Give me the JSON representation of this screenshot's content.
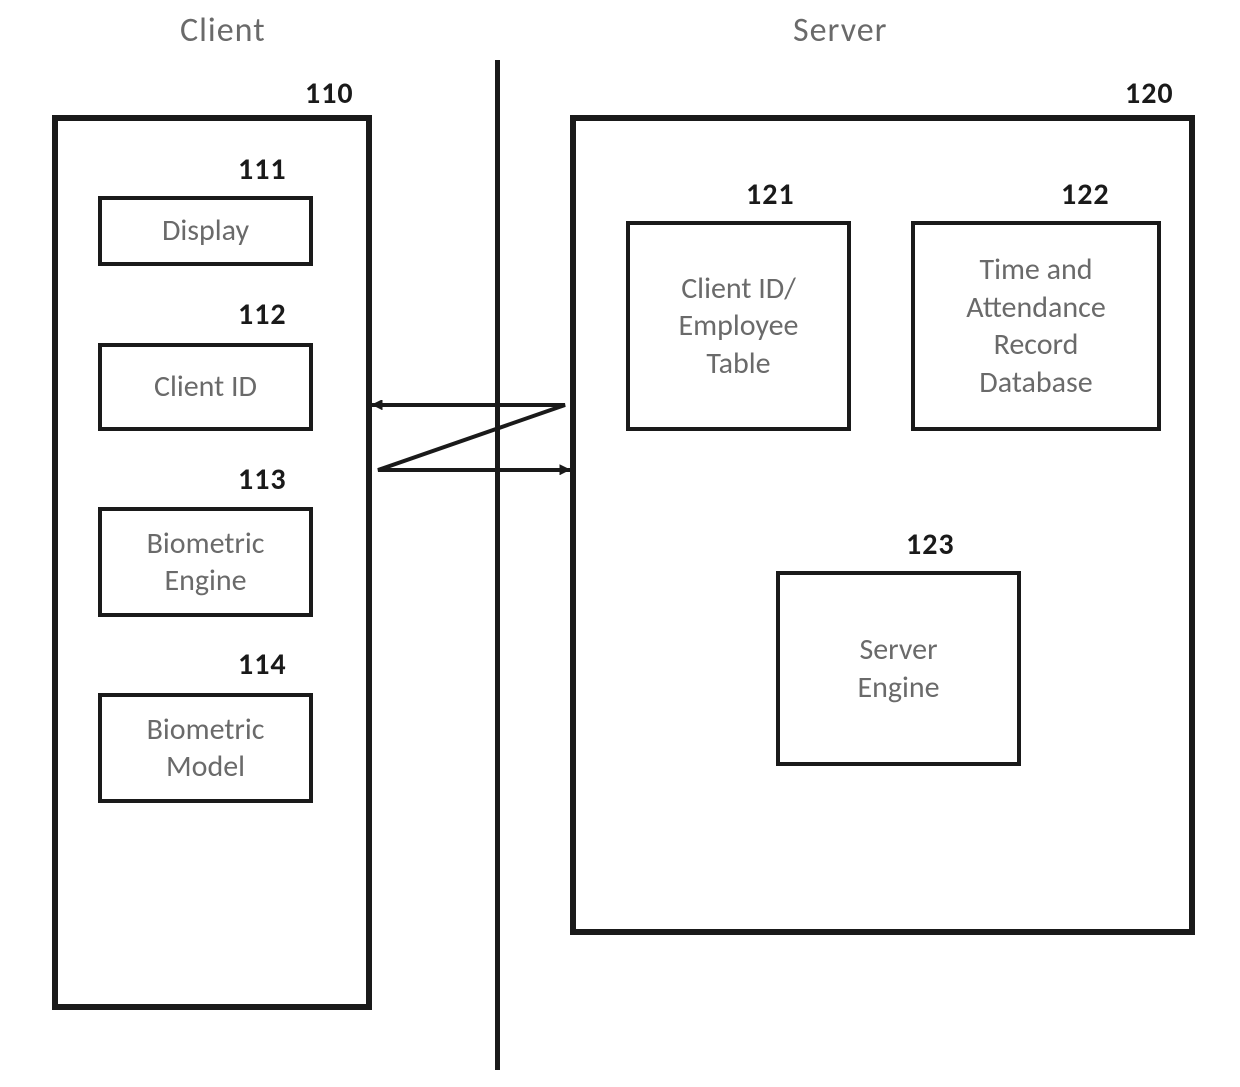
{
  "headers": {
    "client": "Client",
    "server": "Server"
  },
  "client": {
    "ref": "110",
    "display": {
      "ref": "111",
      "label": "Display"
    },
    "clientId": {
      "ref": "112",
      "label": "Client ID"
    },
    "biometricEngine": {
      "ref": "113",
      "label": "Biometric\nEngine"
    },
    "biometricModel": {
      "ref": "114",
      "label": "Biometric\nModel"
    }
  },
  "server": {
    "ref": "120",
    "clientEmployeeTable": {
      "ref": "121",
      "label": "Client ID/\nEmployee\nTable"
    },
    "timeAttendanceDb": {
      "ref": "122",
      "label": "Time and\nAttendance\nRecord\nDatabase"
    },
    "serverEngine": {
      "ref": "123",
      "label": "Server\nEngine"
    }
  }
}
